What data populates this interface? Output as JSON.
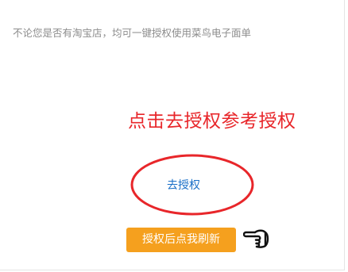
{
  "notice": {
    "text": "不论您是否有淘宝店，均可一键授权使用菜鸟电子面单"
  },
  "annotation": {
    "text": "点击去授权参考授权",
    "color": "#e8262a"
  },
  "auth_link": {
    "label": "去授权",
    "color": "#1a6fc7"
  },
  "refresh_button": {
    "label": "授权后点我刷新",
    "color": "#f5a01e"
  },
  "icons": {
    "pointer": "pointing-hand-icon"
  }
}
